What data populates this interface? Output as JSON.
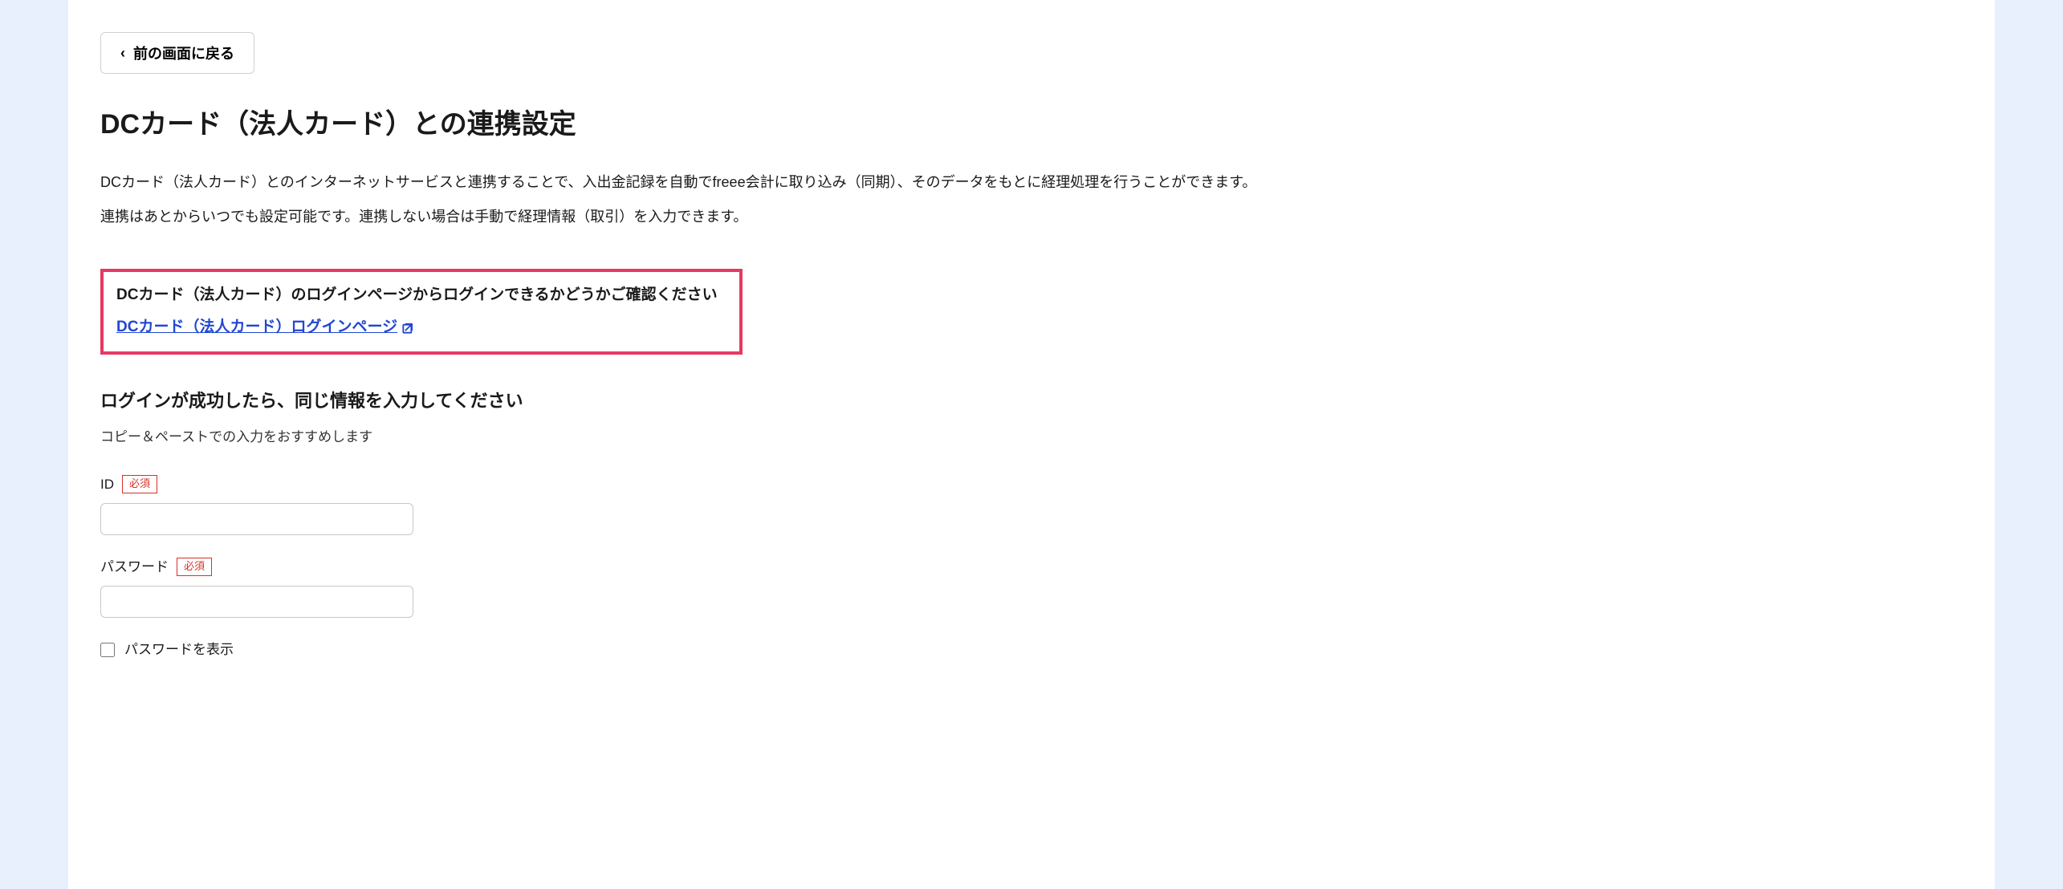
{
  "back_button": {
    "label": "前の画面に戻る"
  },
  "page_title": "DCカード（法人カード）との連携設定",
  "description_line1": "DCカード（法人カード）とのインターネットサービスと連携することで、入出金記録を自動でfreee会計に取り込み（同期）、そのデータをもとに経理処理を行うことができます。",
  "description_line2": "連携はあとからいつでも設定可能です。連携しない場合は手動で経理情報（取引）を入力できます。",
  "highlight": {
    "title": "DCカード（法人カード）のログインページからログインできるかどうかご確認ください",
    "link_text": "DCカード（法人カード）ログインページ"
  },
  "form": {
    "section_title": "ログインが成功したら、同じ情報を入力してください",
    "hint": "コピー＆ペーストでの入力をおすすめします",
    "required_label": "必須",
    "id": {
      "label": "ID",
      "value": ""
    },
    "password": {
      "label": "パスワード",
      "value": ""
    },
    "show_password": {
      "label": "パスワードを表示"
    }
  }
}
